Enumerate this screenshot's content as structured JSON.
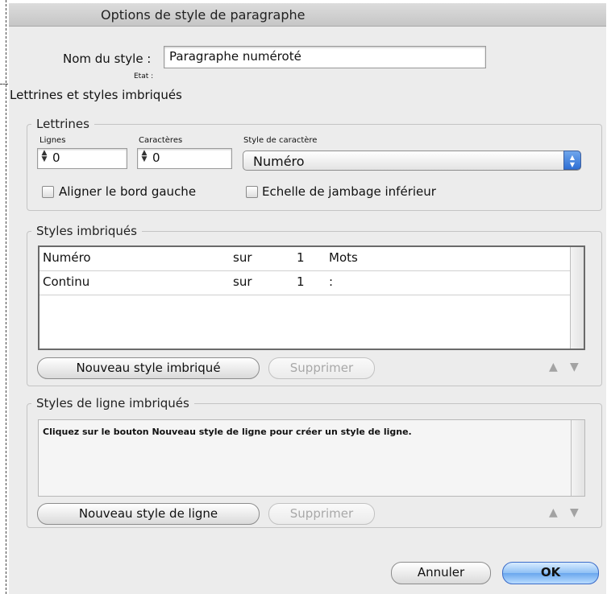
{
  "dialog": {
    "title": "Options de style de paragraphe",
    "style_name_label": "Nom du style :",
    "style_name_value": "Paragraphe numéroté",
    "state_label": "Etat :",
    "section_title": "Lettrines et styles imbriqués"
  },
  "drop_caps": {
    "legend": "Lettrines",
    "lines_label": "Lignes",
    "lines_value": "0",
    "chars_label": "Caractères",
    "chars_value": "0",
    "char_style_label": "Style de caractère",
    "char_style_value": "Numéro",
    "align_left_label": "Aligner le bord gauche",
    "descender_label": "Echelle de jambage inférieur"
  },
  "nested_styles": {
    "legend": "Styles imbriqués",
    "rows": [
      {
        "style": "Numéro",
        "through": "sur",
        "count": "1",
        "unit": "Mots"
      },
      {
        "style": "Continu",
        "through": "sur",
        "count": "1",
        "unit": ":"
      }
    ],
    "new_button": "Nouveau style imbriqué",
    "delete_button": "Supprimer"
  },
  "nested_line_styles": {
    "legend": "Styles de ligne imbriqués",
    "hint": "Cliquez sur le bouton Nouveau style de ligne pour créer un style de ligne.",
    "new_button": "Nouveau style de ligne",
    "delete_button": "Supprimer"
  },
  "footer": {
    "cancel_button": "Annuler",
    "ok_button": "OK"
  }
}
